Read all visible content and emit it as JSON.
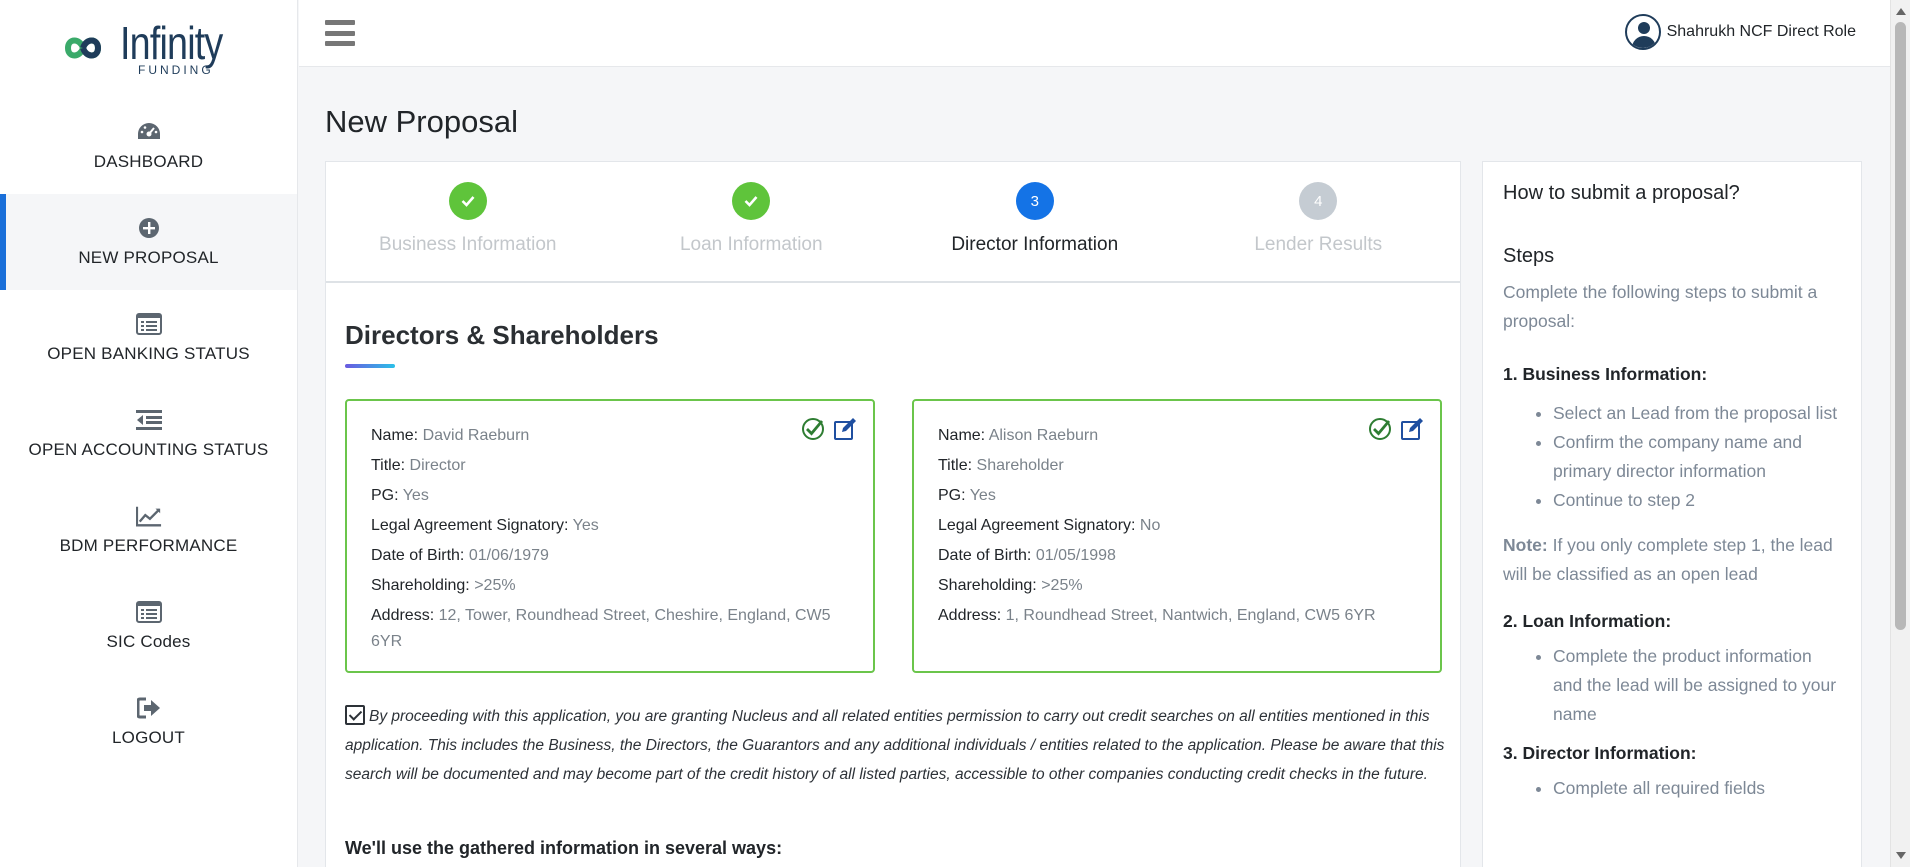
{
  "brand": {
    "name": "Infinity",
    "sub": "FUNDING"
  },
  "sidebar": {
    "items": [
      {
        "label": "DASHBOARD",
        "icon": "dashboard-icon"
      },
      {
        "label": "NEW PROPOSAL",
        "icon": "plus-circle-icon",
        "active": true
      },
      {
        "label": "OPEN BANKING STATUS",
        "icon": "list-icon"
      },
      {
        "label": "OPEN ACCOUNTING STATUS",
        "icon": "indent-icon"
      },
      {
        "label": "BDM PERFORMANCE",
        "icon": "line-chart-icon"
      },
      {
        "label": "SIC Codes",
        "icon": "list-icon"
      },
      {
        "label": "LOGOUT",
        "icon": "sign-out-icon"
      }
    ]
  },
  "header": {
    "user_name": "Shahrukh NCF Direct Role"
  },
  "page": {
    "title": "New Proposal"
  },
  "stepper": [
    {
      "num": "",
      "label": "Business Information",
      "status": "done"
    },
    {
      "num": "",
      "label": "Loan Information",
      "status": "done"
    },
    {
      "num": "3",
      "label": "Director Information",
      "status": "current"
    },
    {
      "num": "4",
      "label": "Lender Results",
      "status": "pending"
    }
  ],
  "section": {
    "title": "Directors & Shareholders"
  },
  "directors": [
    {
      "labels": {
        "name": "Name:",
        "title": "Title:",
        "pg": "PG:",
        "signatory": "Legal Agreement Signatory:",
        "dob": "Date of Birth:",
        "shareholding": "Shareholding:",
        "address": "Address:"
      },
      "name": "David Raeburn",
      "title": "Director",
      "pg": "Yes",
      "signatory": "Yes",
      "dob": "01/06/1979",
      "shareholding": ">25%",
      "address": "12, Tower, Roundhead Street, Cheshire, England, CW5 6YR"
    },
    {
      "labels": {
        "name": "Name:",
        "title": "Title:",
        "pg": "PG:",
        "signatory": "Legal Agreement Signatory:",
        "dob": "Date of Birth:",
        "shareholding": "Shareholding:",
        "address": "Address:"
      },
      "name": "Alison Raeburn",
      "title": "Shareholder",
      "pg": "Yes",
      "signatory": "No",
      "dob": "01/05/1998",
      "shareholding": ">25%",
      "address": "1, Roundhead Street, Nantwich, England, CW5 6YR"
    }
  ],
  "consent": {
    "checked": true,
    "text": "By proceeding with this application, you are granting Nucleus and all related entities permission to carry out credit searches on all entities mentioned in this application. This includes the Business, the Directors, the Guarantors and any additional individuals / entities related to the application. Please be aware that this search will be documented and may become part of the credit history of all listed parties, accessible to other companies conducting credit checks in the future."
  },
  "gather_heading": "We'll use the gathered information in several ways:",
  "help": {
    "title": "How to submit a proposal?",
    "steps_heading": "Steps",
    "intro": "Complete the following steps to submit a proposal:",
    "s1_heading": "1. Business Information:",
    "s1_items": [
      "Select an Lead from the proposal list",
      "Confirm the company name and primary director information",
      "Continue to step 2"
    ],
    "note_label": "Note:",
    "note_text": " If you only complete step 1, the lead will be classified as an open lead",
    "s2_heading": "2. Loan Information:",
    "s2_items": [
      "Complete the product information and the lead will be assigned to your name"
    ],
    "s3_heading": "3. Director Information:",
    "s3_items": [
      "Complete all required fields"
    ]
  },
  "colors": {
    "accent": "#1a6fd9",
    "done": "#5fc43b",
    "current": "#1473e6",
    "card_border": "#6bc54b"
  }
}
